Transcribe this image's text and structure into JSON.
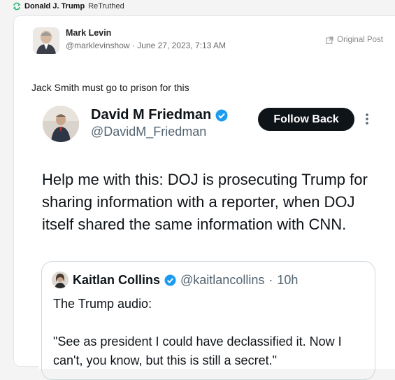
{
  "retruth": {
    "user": "Donald J. Trump",
    "action": "ReTruthed",
    "icon": "retruth-icon"
  },
  "post": {
    "author_name": "Mark Levin",
    "author_handle": "@marklevinshow",
    "separator": "·",
    "timestamp": "June 27, 2023, 7:13 AM",
    "original_post_label": "Original Post",
    "text": "Jack Smith must go to prison for this"
  },
  "tweet": {
    "name": "David M Friedman",
    "handle": "@DavidM_Friedman",
    "follow_label": "Follow Back",
    "body": "Help me with this: DOJ is prosecuting Trump for sharing information with a reporter, when DOJ itself shared the same information with CNN.",
    "verified_color": "#1d9bf0",
    "quote": {
      "name": "Kaitlan Collins",
      "handle": "@kaitlancollins",
      "separator": "·",
      "time": "10h",
      "body": "The Trump audio:\n\n\"See as president I could have declassified it. Now I can't, you know, but this is still a secret.\""
    }
  }
}
